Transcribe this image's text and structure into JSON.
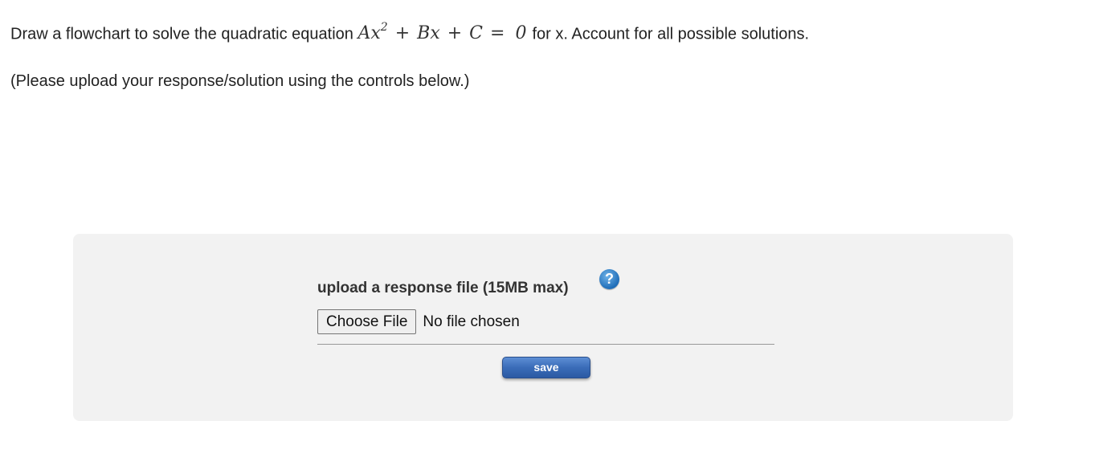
{
  "question": {
    "prefix": "Draw a flowchart to solve the quadratic equation",
    "eq_A": "A",
    "eq_x1": "x",
    "eq_exp": "2",
    "eq_plus1": "+",
    "eq_B": "B",
    "eq_x2": "x",
    "eq_plus2": "+",
    "eq_C": "C",
    "eq_equals": "=",
    "eq_zero": "0",
    "suffix": "for x. Account for all possible solutions."
  },
  "instruction": "(Please upload your response/solution using the controls below.)",
  "upload": {
    "label": "upload a response file (15MB max)",
    "help_icon": "?",
    "choose_file_label": "Choose File",
    "file_status": "No file chosen",
    "save_label": "save"
  }
}
